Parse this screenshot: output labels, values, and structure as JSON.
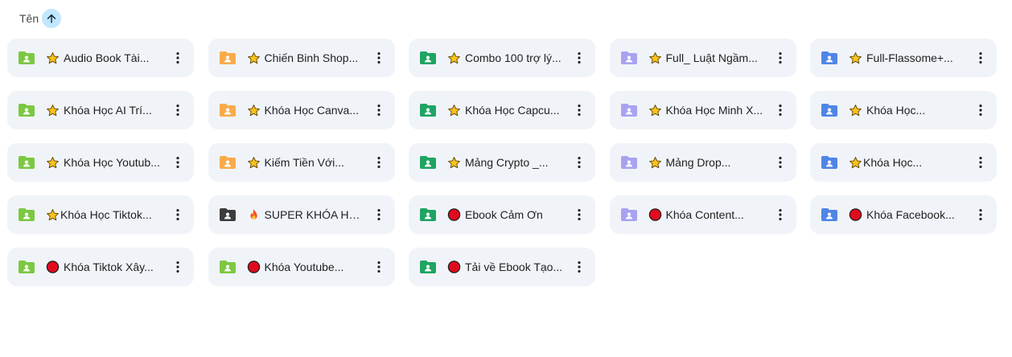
{
  "header": {
    "sort_label": "Tên",
    "sort_direction": "ascending"
  },
  "colors": {
    "green-light": "#7cc843",
    "orange": "#f9ab4c",
    "green-dark": "#1fa463",
    "lavender": "#a8a3f0",
    "blue": "#4f86e6",
    "dark": "#3c3c3c",
    "card_bg": "#f0f4f9",
    "sort_bg": "#c2e7ff"
  },
  "folders": [
    {
      "name": "Audio Book Tài...",
      "color": "green-light",
      "prefix": "star"
    },
    {
      "name": "Chiến Binh Shop...",
      "color": "orange",
      "prefix": "star"
    },
    {
      "name": "Combo 100 trợ lý...",
      "color": "green-dark",
      "prefix": "star"
    },
    {
      "name": "Full_ Luật Ngầm...",
      "color": "lavender",
      "prefix": "star"
    },
    {
      "name": "Full-Flassome+...",
      "color": "blue",
      "prefix": "star"
    },
    {
      "name": "Khóa Học AI Trí...",
      "color": "green-light",
      "prefix": "star"
    },
    {
      "name": "Khóa Học Canva...",
      "color": "orange",
      "prefix": "star"
    },
    {
      "name": "Khóa Học Capcu...",
      "color": "green-dark",
      "prefix": "star"
    },
    {
      "name": "Khóa Học Minh X...",
      "color": "lavender",
      "prefix": "star"
    },
    {
      "name": "Khóa Học...",
      "color": "blue",
      "prefix": "star"
    },
    {
      "name": "Khóa Học Youtub...",
      "color": "green-light",
      "prefix": "star"
    },
    {
      "name": "Kiếm Tiền Với...",
      "color": "orange",
      "prefix": "star"
    },
    {
      "name": "Mảng Crypto _...",
      "color": "green-dark",
      "prefix": "star"
    },
    {
      "name": "Mảng Drop...",
      "color": "lavender",
      "prefix": "star"
    },
    {
      "name": "Khóa Học...",
      "color": "blue",
      "prefix": "star-tight"
    },
    {
      "name": "Khóa Học Tiktok...",
      "color": "green-light",
      "prefix": "star-tight"
    },
    {
      "name": "SUPER KHÓA HỌ...",
      "color": "dark",
      "prefix": "fire"
    },
    {
      "name": "Ebook Cảm Ơn",
      "color": "green-dark",
      "prefix": "red-circle"
    },
    {
      "name": "Khóa Content...",
      "color": "lavender",
      "prefix": "red-circle"
    },
    {
      "name": "Khóa Facebook...",
      "color": "blue",
      "prefix": "red-circle"
    },
    {
      "name": "Khóa Tiktok Xây...",
      "color": "green-light",
      "prefix": "red-circle"
    },
    {
      "name": "Khóa Youtube...",
      "color": "green-light",
      "prefix": "red-circle"
    },
    {
      "name": "Tải về Ebook Tạo...",
      "color": "green-dark",
      "prefix": "red-circle"
    }
  ],
  "icons": {
    "folder": "shared-folder-icon",
    "star": "star-icon",
    "fire": "fire-icon",
    "red-circle": "red-circle-icon",
    "more": "more-vert-icon",
    "sort": "arrow-up-icon"
  }
}
